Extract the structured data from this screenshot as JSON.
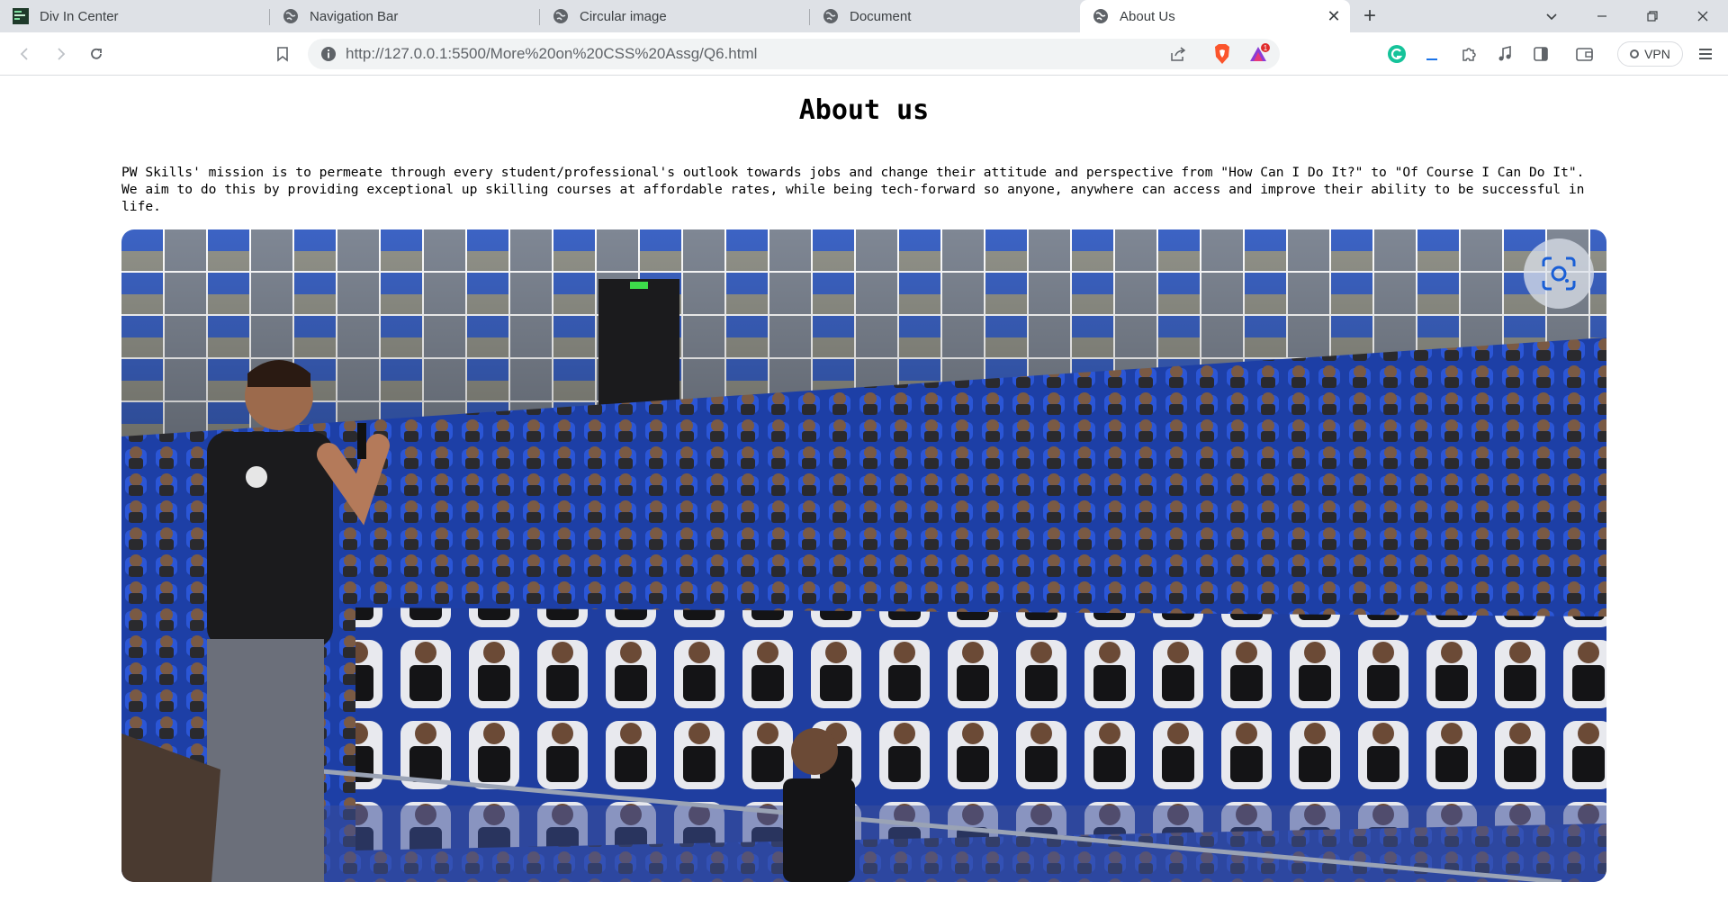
{
  "browser": {
    "tabs": [
      {
        "title": "Div In Center",
        "icon": "code-editor-icon",
        "active": false
      },
      {
        "title": "Navigation Bar",
        "icon": "globe-icon",
        "active": false
      },
      {
        "title": "Circular image",
        "icon": "globe-icon",
        "active": false
      },
      {
        "title": "Document",
        "icon": "globe-icon",
        "active": false
      },
      {
        "title": "About Us",
        "icon": "globe-icon",
        "active": true
      }
    ],
    "address": {
      "url": "http://127.0.0.1:5500/More%20on%20CSS%20Assg/Q6.html"
    },
    "rewards_badge": "1",
    "vpn_label": "VPN",
    "colors": {
      "tabstrip_bg": "#dee1e6",
      "toolbar_bg": "#ffffff",
      "brave_orange": "#fb542b",
      "grammarly_green": "#15c39a"
    }
  },
  "page": {
    "heading": "About us",
    "paragraph": "PW Skills' mission is to permeate through every student/professional's outlook towards jobs and change their attitude and perspective from \"How Can I Do It?\" to \"Of Course I Can Do It\". We aim to do this by providing exceptional up skilling courses at affordable rates, while being tech-forward so anyone, anywhere can access and improve their ability to be successful in life.",
    "image_icon": "visual-search-icon"
  }
}
